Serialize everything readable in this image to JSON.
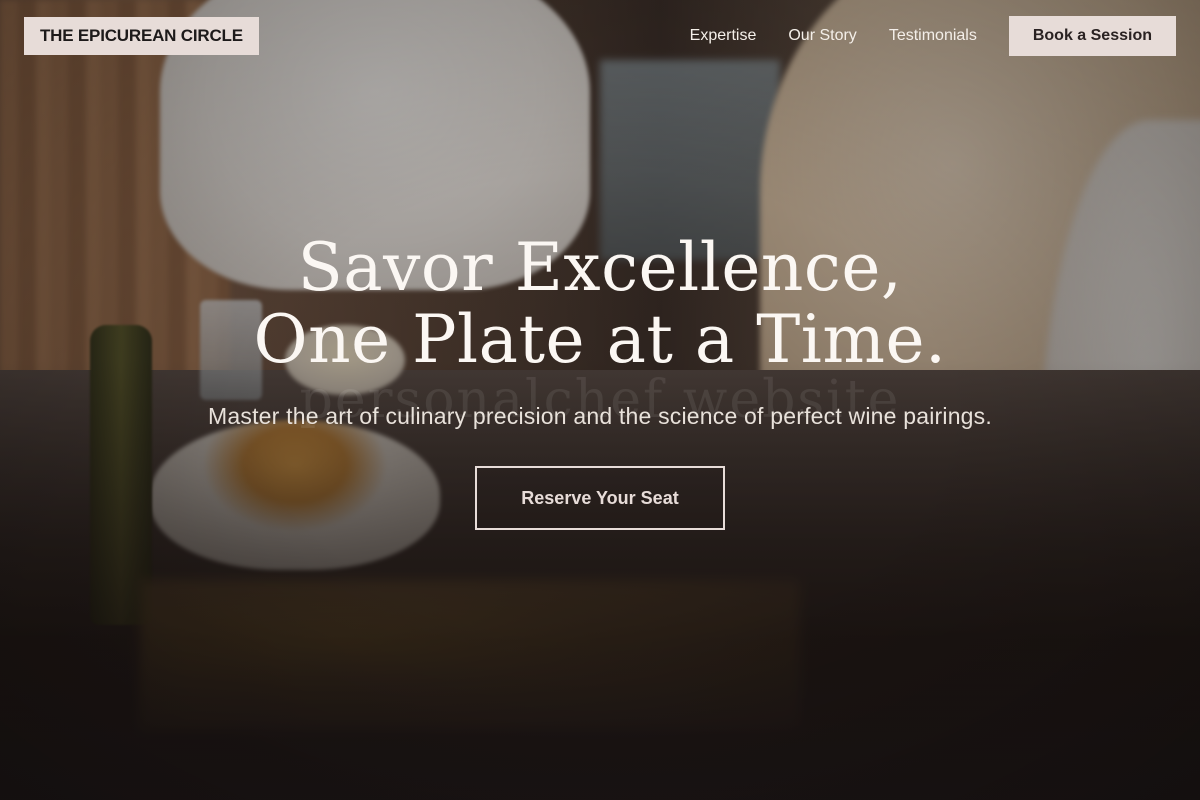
{
  "brand": {
    "logo_text": "THE EPICUREAN CIRCLE"
  },
  "nav": {
    "items": [
      {
        "label": "Expertise"
      },
      {
        "label": "Our Story"
      },
      {
        "label": "Testimonials"
      }
    ],
    "cta_label": "Book a Session"
  },
  "hero": {
    "title": "Savor Excellence, One Plate at a Time.",
    "watermark": "personalchef website",
    "subtitle": "Master the art of culinary precision and the science of perfect wine pairings.",
    "cta_label": "Reserve Your Seat"
  },
  "colors": {
    "accent_bg": "#e7dcd8",
    "text_light": "#fbf7f3",
    "overlay_dark": "#1c1513"
  }
}
